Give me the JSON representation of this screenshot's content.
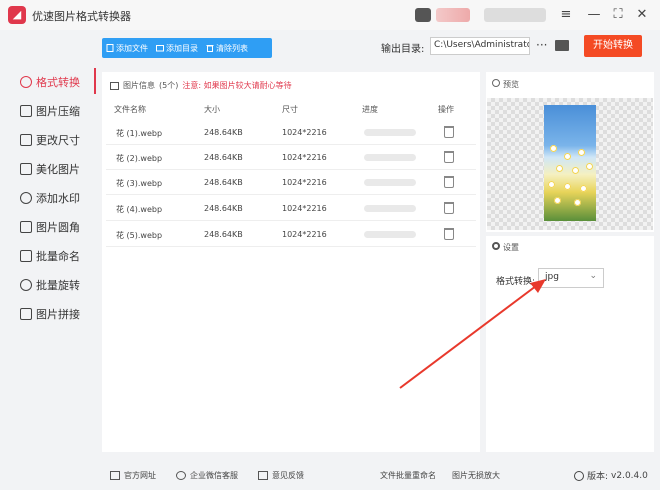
{
  "app": {
    "title": "优速图片格式转换器",
    "logo_glyph": "◢",
    "accent": "#e0384c"
  },
  "window": {
    "menu_icon": "≡",
    "minimize_icon": "—",
    "maximize_icon": "⛶",
    "close_icon": "✕"
  },
  "toolbar": {
    "add_file": "添加文件",
    "add_folder": "添加目录",
    "clear_list": "清除列表",
    "output_label": "输出目录:",
    "output_path": "C:\\Users\\Administrator\\",
    "more": "···",
    "start": "开始转换"
  },
  "sidebar": {
    "items": [
      {
        "label": "格式转换",
        "icon": "convert-icon"
      },
      {
        "label": "图片压缩",
        "icon": "compress-icon"
      },
      {
        "label": "更改尺寸",
        "icon": "resize-icon"
      },
      {
        "label": "美化图片",
        "icon": "beautify-icon"
      },
      {
        "label": "添加水印",
        "icon": "watermark-icon"
      },
      {
        "label": "图片圆角",
        "icon": "rounded-corner-icon"
      },
      {
        "label": "批量命名",
        "icon": "rename-icon"
      },
      {
        "label": "批量旋转",
        "icon": "rotate-icon"
      },
      {
        "label": "图片拼接",
        "icon": "stitch-icon"
      }
    ]
  },
  "files": {
    "header": "图片信息",
    "count": "(5个)",
    "notice": "注意: 如果图片较大请耐心等待",
    "columns": [
      "文件名称",
      "大小",
      "尺寸",
      "进度",
      "操作"
    ],
    "rows": [
      {
        "name": "花 (1).webp",
        "size": "248.64KB",
        "dims": "1024*2216",
        "progress": 0
      },
      {
        "name": "花 (2).webp",
        "size": "248.64KB",
        "dims": "1024*2216",
        "progress": 0
      },
      {
        "name": "花 (3).webp",
        "size": "248.64KB",
        "dims": "1024*2216",
        "progress": 0
      },
      {
        "name": "花 (4).webp",
        "size": "248.64KB",
        "dims": "1024*2216",
        "progress": 0
      },
      {
        "name": "花 (5).webp",
        "size": "248.64KB",
        "dims": "1024*2216",
        "progress": 0
      }
    ]
  },
  "preview": {
    "title": "预览"
  },
  "settings": {
    "title": "设置",
    "format_label": "格式转换:",
    "format_value": "jpg"
  },
  "footer": {
    "official_site": "官方网址",
    "wechat_service": "企业微信客服",
    "feedback": "意见反馈",
    "batch_rename": "文件批量重命名",
    "lossless_upscale": "图片无损放大",
    "version_label": "版本:",
    "version": "v2.0.4.0"
  },
  "annotation": {
    "arrow_color": "#e8392c"
  }
}
